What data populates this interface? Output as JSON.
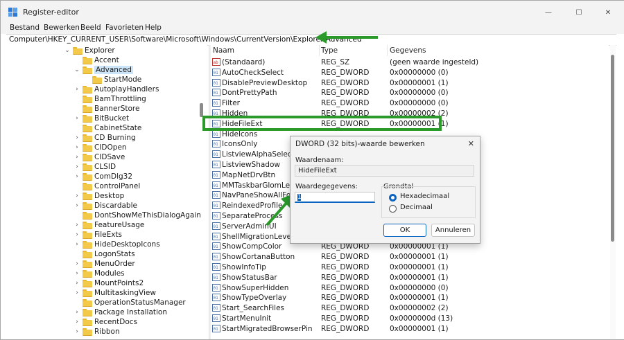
{
  "window": {
    "title": "Register-editor",
    "controls": {
      "minimize": "—",
      "maximize": "☐",
      "close": "✕"
    }
  },
  "menu": [
    "Bestand",
    "Bewerken",
    "Beeld",
    "Favorieten",
    "Help"
  ],
  "address": "Computer\\HKEY_CURRENT_USER\\Software\\Microsoft\\Windows\\CurrentVersion\\Explorer\\Advanced",
  "tree": [
    {
      "label": "Explorer",
      "expanded": true,
      "level": 0
    },
    {
      "label": "Accent",
      "expanded": false,
      "level": 1,
      "leaf": true
    },
    {
      "label": "Advanced",
      "expanded": true,
      "level": 1,
      "selected": true
    },
    {
      "label": "StartMode",
      "level": 2,
      "leaf": true
    },
    {
      "label": "AutoplayHandlers",
      "level": 1
    },
    {
      "label": "BamThrottling",
      "level": 1,
      "leaf": true
    },
    {
      "label": "BannerStore",
      "level": 1,
      "leaf": true
    },
    {
      "label": "BitBucket",
      "level": 1
    },
    {
      "label": "CabinetState",
      "level": 1,
      "leaf": true
    },
    {
      "label": "CD Burning",
      "level": 1
    },
    {
      "label": "CIDOpen",
      "level": 1
    },
    {
      "label": "CIDSave",
      "level": 1
    },
    {
      "label": "CLSID",
      "level": 1
    },
    {
      "label": "ComDlg32",
      "level": 1
    },
    {
      "label": "ControlPanel",
      "level": 1,
      "leaf": true
    },
    {
      "label": "Desktop",
      "level": 1
    },
    {
      "label": "Discardable",
      "level": 1
    },
    {
      "label": "DontShowMeThisDialogAgain",
      "level": 1,
      "leaf": true
    },
    {
      "label": "FeatureUsage",
      "level": 1
    },
    {
      "label": "FileExts",
      "level": 1
    },
    {
      "label": "HideDesktopIcons",
      "level": 1
    },
    {
      "label": "LogonStats",
      "level": 1,
      "leaf": true
    },
    {
      "label": "MenuOrder",
      "level": 1
    },
    {
      "label": "Modules",
      "level": 1
    },
    {
      "label": "MountPoints2",
      "level": 1
    },
    {
      "label": "MultitaskingView",
      "level": 1
    },
    {
      "label": "OperationStatusManager",
      "level": 1,
      "leaf": true
    },
    {
      "label": "Package Installation",
      "level": 1
    },
    {
      "label": "RecentDocs",
      "level": 1
    },
    {
      "label": "Ribbon",
      "level": 1
    }
  ],
  "columns": {
    "name": "Naam",
    "type": "Type",
    "data": "Gegevens"
  },
  "values": [
    {
      "name": "(Standaard)",
      "type": "REG_SZ",
      "data": "(geen waarde ingesteld)",
      "icon": "string"
    },
    {
      "name": "AutoCheckSelect",
      "type": "REG_DWORD",
      "data": "0x00000000 (0)"
    },
    {
      "name": "DisablePreviewDesktop",
      "type": "REG_DWORD",
      "data": "0x00000001 (1)"
    },
    {
      "name": "DontPrettyPath",
      "type": "REG_DWORD",
      "data": "0x00000000 (0)"
    },
    {
      "name": "Filter",
      "type": "REG_DWORD",
      "data": "0x00000000 (0)"
    },
    {
      "name": "Hidden",
      "type": "REG_DWORD",
      "data": "0x00000002 (2)"
    },
    {
      "name": "HideFileExt",
      "type": "REG_DWORD",
      "data": "0x00000001 (1)"
    },
    {
      "name": "HideIcons",
      "type": "",
      "data": ""
    },
    {
      "name": "IconsOnly",
      "type": "",
      "data": ""
    },
    {
      "name": "ListviewAlphaSelect",
      "type": "",
      "data": ""
    },
    {
      "name": "ListviewShadow",
      "type": "",
      "data": ""
    },
    {
      "name": "MapNetDrvBtn",
      "type": "",
      "data": ""
    },
    {
      "name": "MMTaskbarGlomLevel",
      "type": "",
      "data": ""
    },
    {
      "name": "NavPaneShowAllFolde",
      "type": "",
      "data": ""
    },
    {
      "name": "ReindexedProfile",
      "type": "",
      "data": ""
    },
    {
      "name": "SeparateProcess",
      "type": "",
      "data": ""
    },
    {
      "name": "ServerAdminUI",
      "type": "",
      "data": ""
    },
    {
      "name": "ShellMigrationLevel",
      "type": "",
      "data": ""
    },
    {
      "name": "ShowCompColor",
      "type": "REG_DWORD",
      "data": "0x00000001 (1)"
    },
    {
      "name": "ShowCortanaButton",
      "type": "REG_DWORD",
      "data": "0x00000001 (1)"
    },
    {
      "name": "ShowInfoTip",
      "type": "REG_DWORD",
      "data": "0x00000001 (1)"
    },
    {
      "name": "ShowStatusBar",
      "type": "REG_DWORD",
      "data": "0x00000001 (1)"
    },
    {
      "name": "ShowSuperHidden",
      "type": "REG_DWORD",
      "data": "0x00000000 (0)"
    },
    {
      "name": "ShowTypeOverlay",
      "type": "REG_DWORD",
      "data": "0x00000001 (1)"
    },
    {
      "name": "Start_SearchFiles",
      "type": "REG_DWORD",
      "data": "0x00000002 (2)"
    },
    {
      "name": "StartMenuInit",
      "type": "REG_DWORD",
      "data": "0x0000000d (13)"
    },
    {
      "name": "StartMigratedBrowserPin",
      "type": "REG_DWORD",
      "data": "0x00000001 (1)"
    }
  ],
  "dialog": {
    "title": "DWORD (32 bits)-waarde bewerken",
    "close": "✕",
    "name_label": "Waardenaam:",
    "name_value": "HideFileExt",
    "data_label": "Waardegegevens:",
    "data_value": "1",
    "base_label": "Grondtal",
    "hex_label": "Hexadecimaal",
    "dec_label": "Decimaal",
    "ok": "OK",
    "cancel": "Annuleren"
  },
  "colors": {
    "annotation_green": "#2b9a2b",
    "selection": "#cce4f7",
    "accent": "#0a64c0"
  }
}
